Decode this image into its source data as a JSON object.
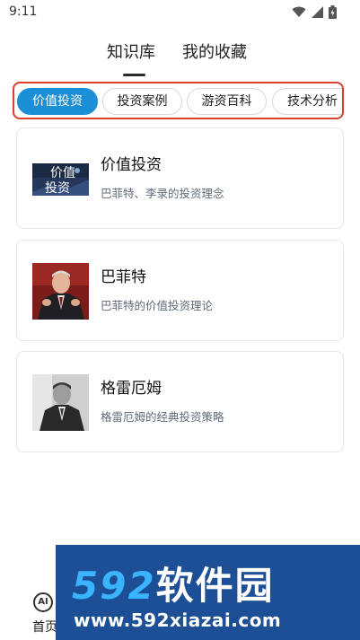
{
  "status_bar": {
    "time": "9:11",
    "icons": [
      "wifi-icon",
      "signal-icon",
      "battery-icon"
    ]
  },
  "top_tabs": [
    {
      "label": "知识库",
      "active": true
    },
    {
      "label": "我的收藏",
      "active": false
    }
  ],
  "categories": [
    {
      "label": "价值投资",
      "active": true
    },
    {
      "label": "投资案例",
      "active": false
    },
    {
      "label": "游资百科",
      "active": false
    },
    {
      "label": "技术分析",
      "active": false
    }
  ],
  "cards": [
    {
      "title": "价值投资",
      "desc": "巴菲特、李录的投资理念",
      "thumb_text": [
        "价值",
        "投资"
      ]
    },
    {
      "title": "巴菲特",
      "desc": "巴菲特的价值投资理论"
    },
    {
      "title": "格雷厄姆",
      "desc": "格雷厄姆的经典投资策略"
    }
  ],
  "bottom_nav": {
    "home_icon_text": "AI",
    "home_label": "首页"
  },
  "watermark": {
    "brand_num": "592",
    "brand_cn": "软件园",
    "url": "www.592xiazai.com"
  },
  "colors": {
    "accent": "#1a8fd6",
    "highlight_border": "#d9412b",
    "watermark_bg": "#1d4f96"
  }
}
